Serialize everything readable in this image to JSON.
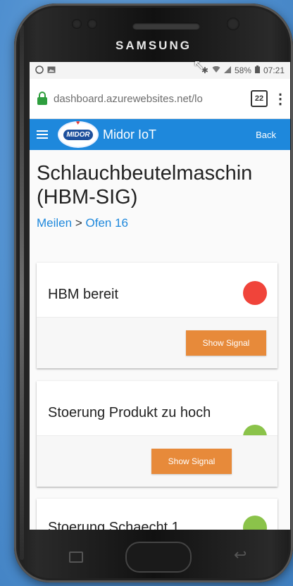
{
  "device": {
    "brand": "SAMSUNG"
  },
  "statusbar": {
    "left_icons": [
      "whatsapp-icon",
      "image-icon"
    ],
    "battery": "58%",
    "time": "07:21"
  },
  "browser": {
    "url": "dashboard.azurewebsites.net/lo",
    "tab_count": "22",
    "menu_glyph": "⋮"
  },
  "appbar": {
    "logo_text": "MIDOR",
    "title": "Midor IoT",
    "back_label": "Back"
  },
  "page": {
    "title_line1": "Schlauchbeutelmaschin",
    "title_line2": "(HBM-SIG)",
    "breadcrumb": {
      "parent": "Meilen",
      "separator": ">",
      "current": "Ofen 16"
    }
  },
  "cards": [
    {
      "title": "HBM bereit",
      "status_color": "#f0443a",
      "button_label": "Show Signal"
    },
    {
      "title": "Stoerung Produkt zu hoch",
      "status_color": "#8bc34a",
      "button_label": "Show Signal"
    },
    {
      "title": "Stoerung Schaecht 1",
      "status_color": "#8bc34a"
    }
  ],
  "colors": {
    "accent": "#1e88dc",
    "button": "#e78a3a"
  }
}
